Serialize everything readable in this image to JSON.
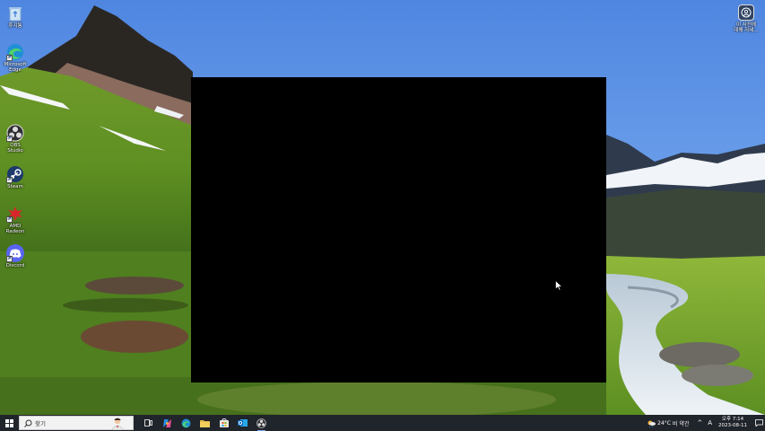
{
  "desktop": {
    "icons": [
      {
        "label": "휴지통",
        "icon": "recycle-bin-icon"
      },
      {
        "label": "Microsoft Edge",
        "icon": "edge-icon"
      },
      {
        "label": "OBS Studio",
        "icon": "obs-icon"
      },
      {
        "label": "Steam",
        "icon": "steam-icon"
      },
      {
        "label": "AMD Radeon",
        "icon": "amd-icon"
      },
      {
        "label": "Discord",
        "icon": "discord-icon"
      }
    ],
    "widget": {
      "label_line1": "이 사진에",
      "label_line2": "대해 자세...",
      "icon": "learn-about-picture-icon"
    }
  },
  "taskbar": {
    "search_placeholder": "찾기",
    "apps": [
      {
        "name": "task-view",
        "icon": "task-view-icon"
      },
      {
        "name": "copilot",
        "icon": "copilot-icon"
      },
      {
        "name": "edge",
        "icon": "edge-icon"
      },
      {
        "name": "file-explorer",
        "icon": "folder-icon"
      },
      {
        "name": "store",
        "icon": "store-icon"
      },
      {
        "name": "outlook",
        "icon": "outlook-icon"
      },
      {
        "name": "obs",
        "icon": "obs-icon"
      }
    ],
    "weather": {
      "temp": "24°C",
      "condition": "비 약간"
    },
    "ime": "A",
    "clock": {
      "time": "오후 7:14",
      "date": "2023-08-11"
    }
  },
  "colors": {
    "taskbar_bg": "#20242b",
    "window_bg": "#000000",
    "accent": "#7aa7e8"
  }
}
